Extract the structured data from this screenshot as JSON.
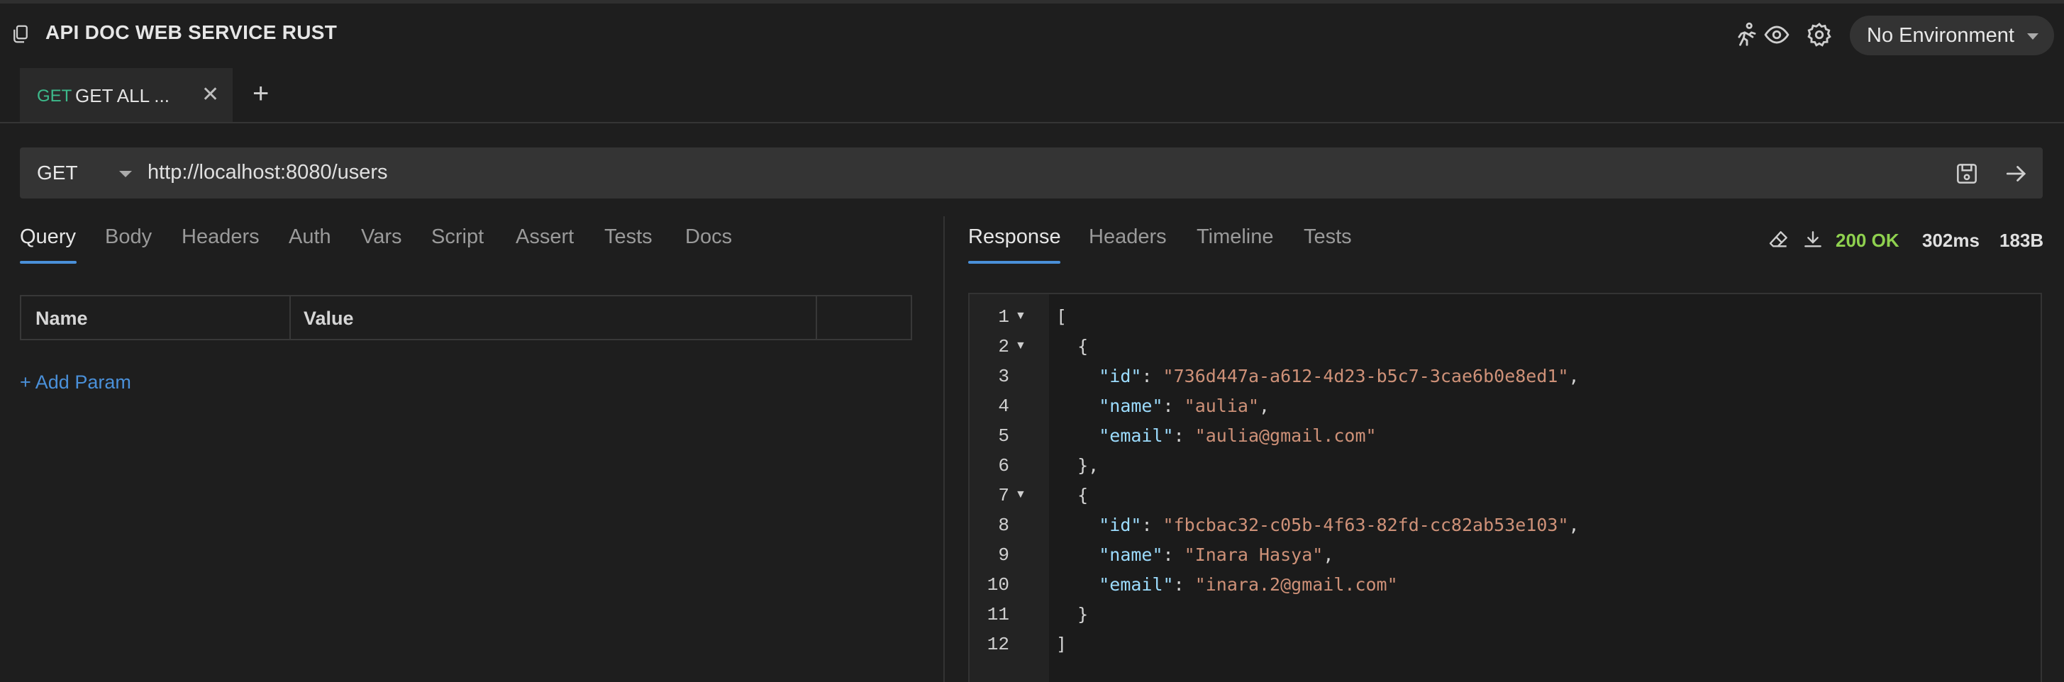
{
  "app": {
    "title": "API DOC WEB SERVICE RUST"
  },
  "header": {
    "environment": "No Environment"
  },
  "tabs": [
    {
      "method": "GET",
      "name": "GET ALL ...",
      "close": "✕"
    }
  ],
  "add_tab": "+",
  "request": {
    "method": "GET",
    "url": "http://localhost:8080/users",
    "subtabs": [
      "Query",
      "Body",
      "Headers",
      "Auth",
      "Vars",
      "Script",
      "Assert",
      "Tests",
      "Docs"
    ],
    "params": {
      "columns": [
        "Name",
        "Value"
      ],
      "add_label": "+ Add Param"
    }
  },
  "response": {
    "subtabs": [
      "Response",
      "Headers",
      "Timeline",
      "Tests"
    ],
    "status": "200 OK",
    "time": "302ms",
    "size": "183B",
    "line_numbers": [
      "1",
      "2",
      "3",
      "4",
      "5",
      "6",
      "7",
      "8",
      "9",
      "10",
      "11",
      "12"
    ],
    "body": {
      "users": [
        {
          "id": "\"736d447a-a612-4d23-b5c7-3cae6b0e8ed1\"",
          "name": "\"aulia\"",
          "email": "\"aulia@gmail.com\""
        },
        {
          "id": "\"fbcbac32-c05b-4f63-82fd-cc82ab53e103\"",
          "name": "\"Inara Hasya\"",
          "email": "\"inara.2@gmail.com\""
        }
      ],
      "keys": {
        "id": "\"id\"",
        "name": "\"name\"",
        "email": "\"email\""
      }
    }
  },
  "colors": {
    "accent": "#4a90d9",
    "get_method": "#3dba8b",
    "status_ok": "#8fd14f",
    "json_key": "#9cdcfe",
    "json_string": "#ce9178"
  }
}
